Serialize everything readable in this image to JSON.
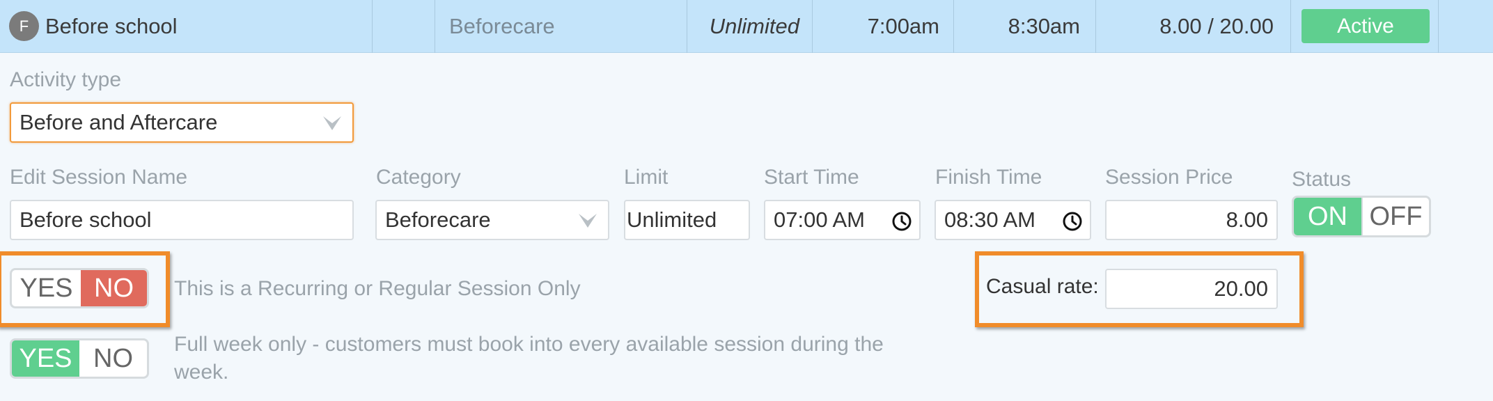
{
  "session_row": {
    "avatar_letter": "F",
    "name": "Before school",
    "category": "Beforecare",
    "limit": "Unlimited",
    "start_time": "7:00am",
    "finish_time": "8:30am",
    "price": "8.00 / 20.00",
    "status": "Active"
  },
  "activity_type": {
    "label": "Activity type",
    "value": "Before and Aftercare"
  },
  "form": {
    "name_label": "Edit Session Name",
    "name_value": "Before school",
    "category_label": "Category",
    "category_value": "Beforecare",
    "limit_label": "Limit",
    "limit_value": "Unlimited",
    "start_label": "Start Time",
    "start_value": "07:00 AM",
    "finish_label": "Finish Time",
    "finish_value": "08:30 AM",
    "price_label": "Session Price",
    "price_value": "8.00",
    "status_label": "Status",
    "status_on": "ON",
    "status_off": "OFF"
  },
  "recurring": {
    "yes": "YES",
    "no": "NO",
    "selected": "NO",
    "description": "This is a Recurring or Regular Session Only"
  },
  "full_week": {
    "yes": "YES",
    "no": "NO",
    "selected": "YES",
    "description": "Full week only - customers must book into every available session during the week."
  },
  "casual": {
    "label": "Casual rate:",
    "value": "20.00"
  },
  "colors": {
    "row_bg": "#c4e4fa",
    "active_green": "#5fcf8f",
    "no_red": "#e06a5d",
    "highlight_orange": "#f08c2a"
  }
}
